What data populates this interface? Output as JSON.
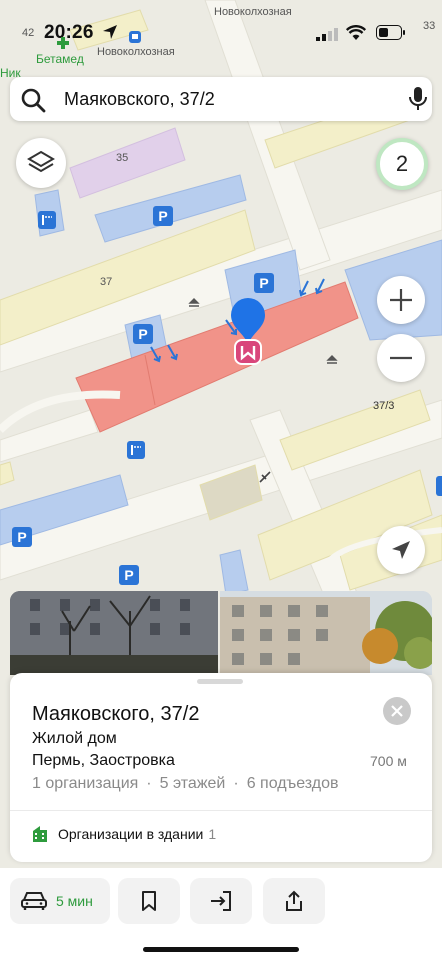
{
  "status_bar": {
    "time": "20:26"
  },
  "map": {
    "labels": {
      "num_42": "42",
      "num_33": "33",
      "novokolkhoznaya_top": "Новоколхозная",
      "novokolkhoznaya_stop": "Новоколхозная",
      "betamed": "Бетамед",
      "nik": "Ник",
      "building_35": "35",
      "building_37": "37",
      "building_37_3": "37/3"
    },
    "parking_label": "P",
    "cluster_count": "2"
  },
  "search": {
    "query": "Маяковского, 37/2"
  },
  "card": {
    "title": "Маяковского, 37/2",
    "type": "Жилой дом",
    "city": "Пермь, Заостровка",
    "distance": "700 м",
    "meta": [
      "1 организация",
      "5 этажей",
      "6 подъездов"
    ],
    "org_label": "Организации в здании",
    "org_count": "1"
  },
  "actions": {
    "route_eta": "5 мин"
  },
  "colors": {
    "map_bg": "#ecebe3",
    "road": "#f7f6f0",
    "building": "#f3efc9",
    "parking": "#b7cdee",
    "selected_building": "#f19389",
    "pin": "#1f73e6",
    "accent_green": "#2e9b3d"
  }
}
